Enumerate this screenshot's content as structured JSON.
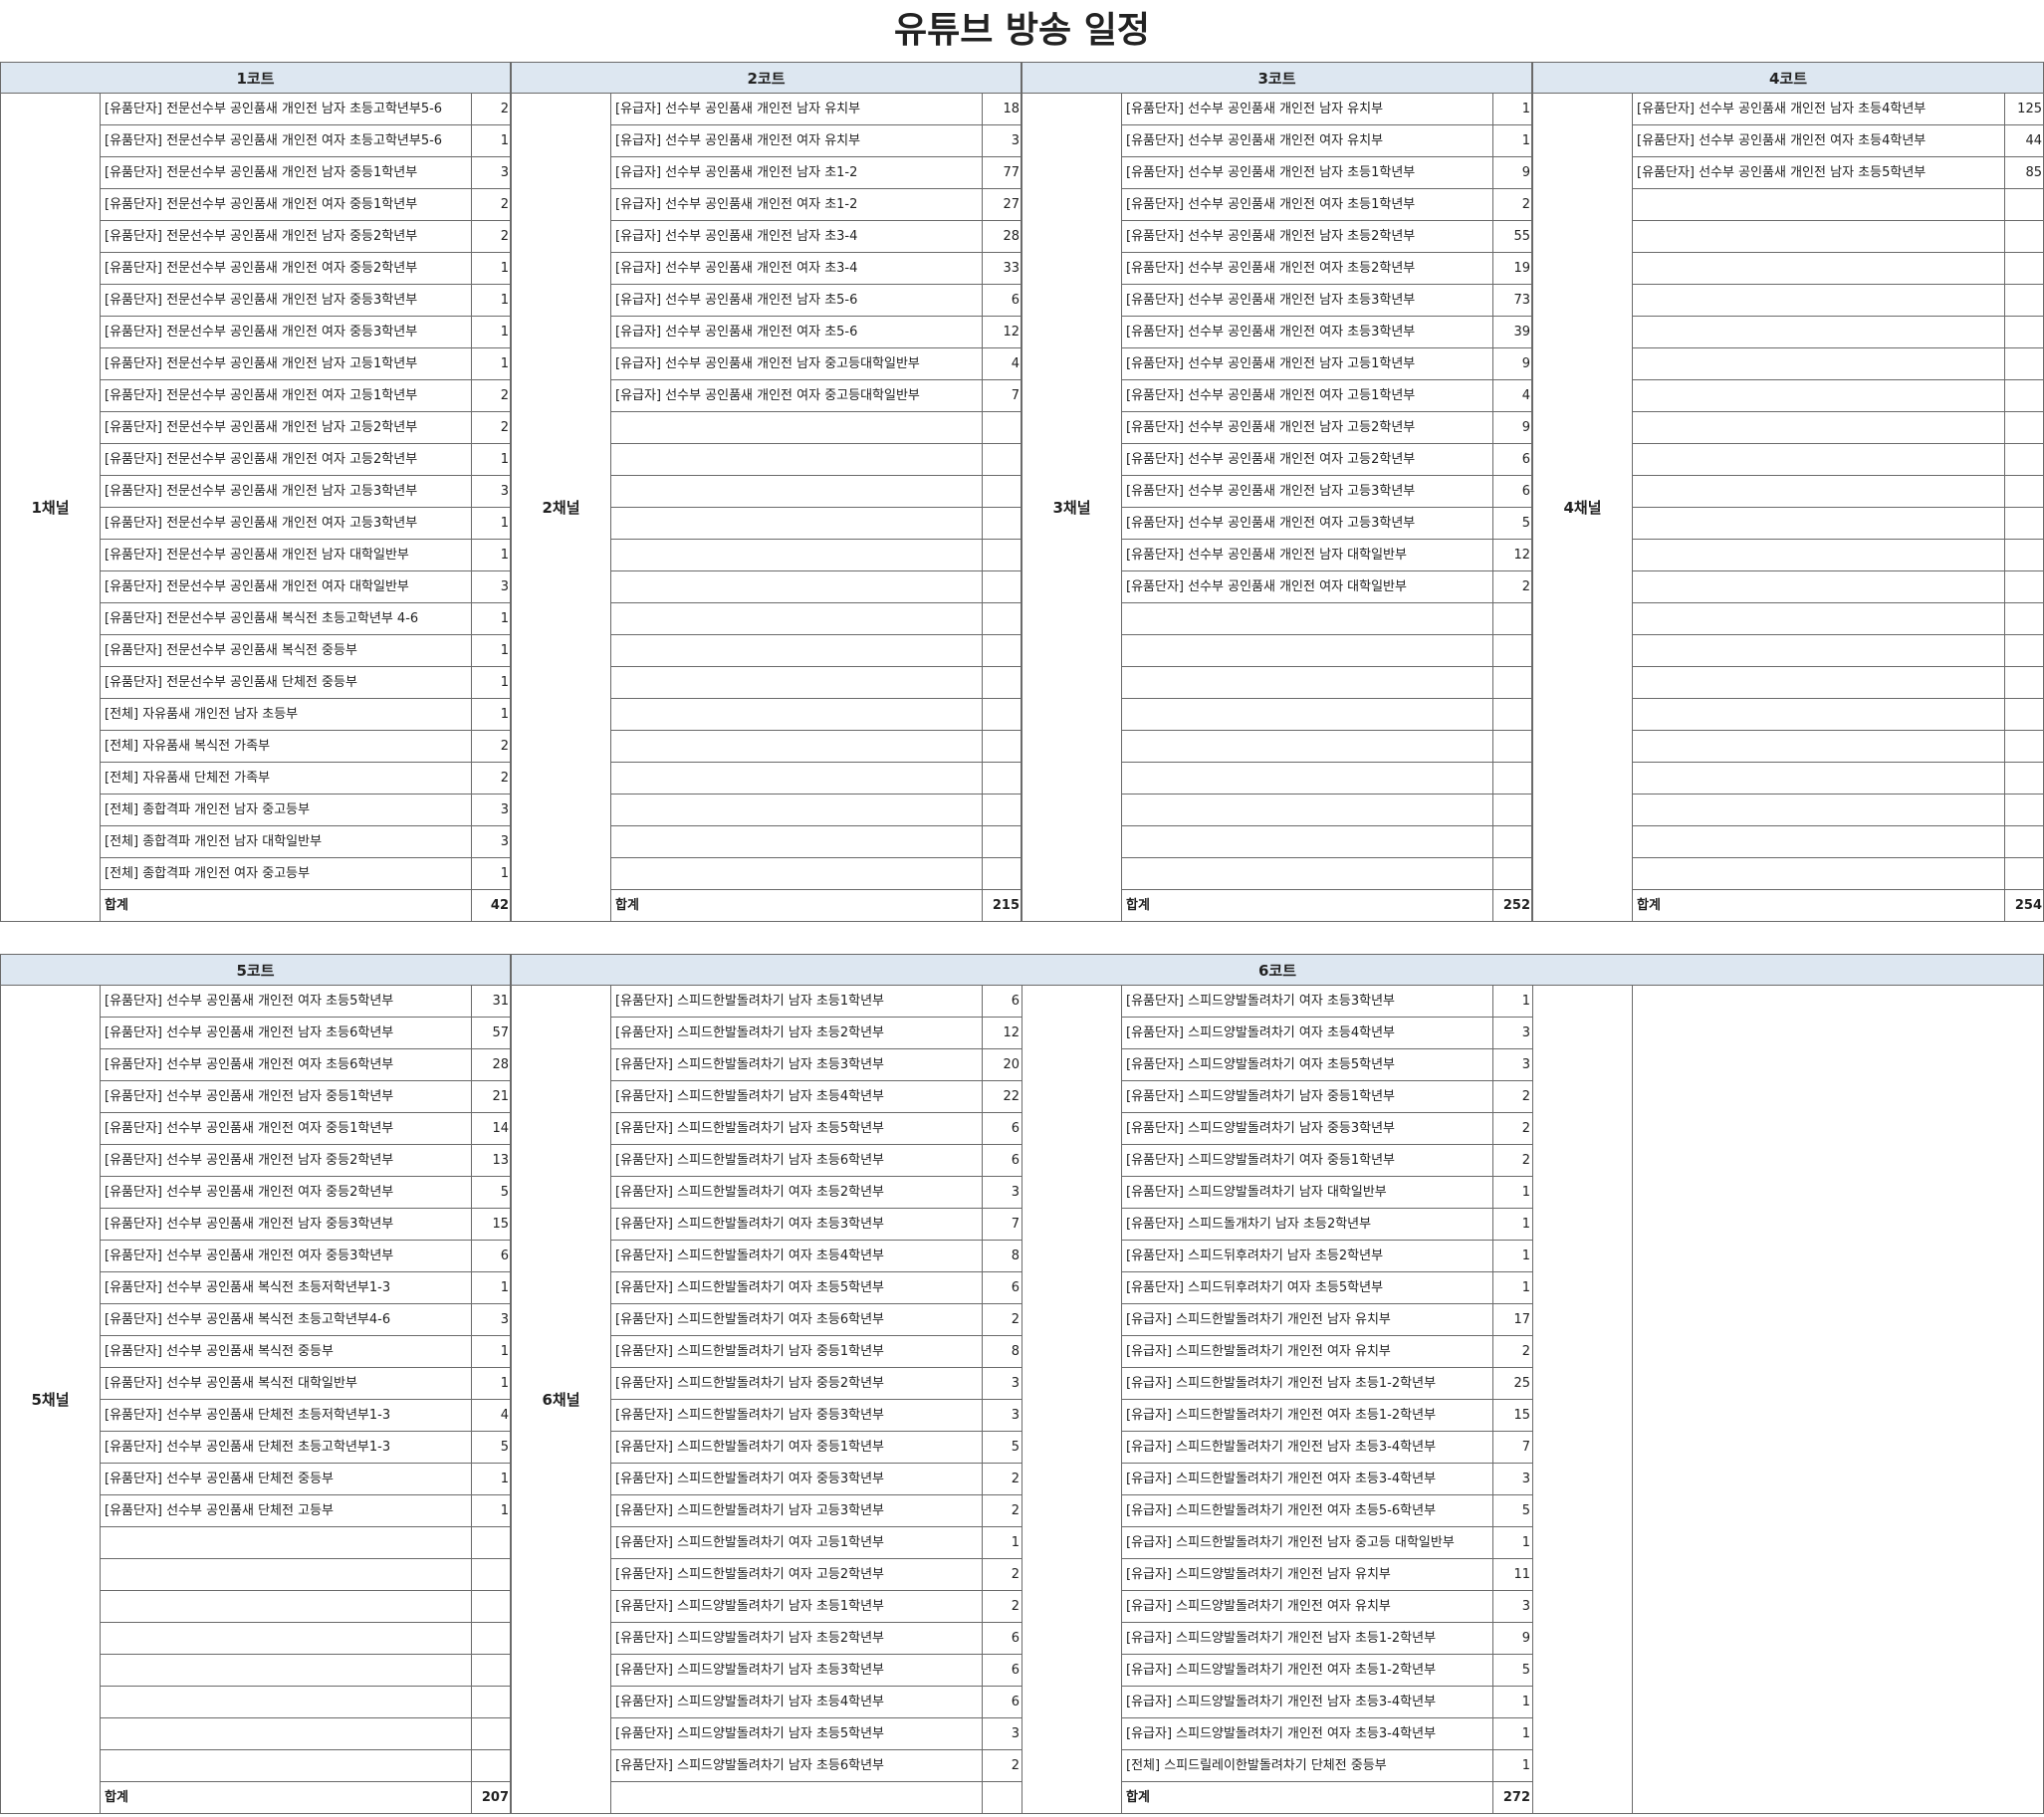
{
  "title": "유튜브 방송 일정",
  "total_label": "합계",
  "courts": [
    {
      "label": "1코트",
      "channel": "1채널",
      "total": "42",
      "entries": [
        [
          "[유품단자] 전문선수부 공인품새 개인전 남자 초등고학년부5-6",
          "2"
        ],
        [
          "[유품단자] 전문선수부 공인품새 개인전 여자 초등고학년부5-6",
          "1"
        ],
        [
          "[유품단자] 전문선수부 공인품새 개인전 남자 중등1학년부",
          "3"
        ],
        [
          "[유품단자] 전문선수부 공인품새 개인전 여자 중등1학년부",
          "2"
        ],
        [
          "[유품단자] 전문선수부 공인품새 개인전 남자 중등2학년부",
          "2"
        ],
        [
          "[유품단자] 전문선수부 공인품새 개인전 여자 중등2학년부",
          "1"
        ],
        [
          "[유품단자] 전문선수부 공인품새 개인전 남자 중등3학년부",
          "1"
        ],
        [
          "[유품단자] 전문선수부 공인품새 개인전 여자 중등3학년부",
          "1"
        ],
        [
          "[유품단자] 전문선수부 공인품새 개인전 남자 고등1학년부",
          "1"
        ],
        [
          "[유품단자] 전문선수부 공인품새 개인전 여자 고등1학년부",
          "2"
        ],
        [
          "[유품단자] 전문선수부 공인품새 개인전 남자 고등2학년부",
          "2"
        ],
        [
          "[유품단자] 전문선수부 공인품새 개인전 여자 고등2학년부",
          "1"
        ],
        [
          "[유품단자] 전문선수부 공인품새 개인전 남자 고등3학년부",
          "3"
        ],
        [
          "[유품단자] 전문선수부 공인품새 개인전 여자 고등3학년부",
          "1"
        ],
        [
          "[유품단자] 전문선수부 공인품새 개인전 남자 대학일반부",
          "1"
        ],
        [
          "[유품단자] 전문선수부 공인품새 개인전 여자 대학일반부",
          "3"
        ],
        [
          "[유품단자] 전문선수부 공인품새 복식전 초등고학년부 4-6",
          "1"
        ],
        [
          "[유품단자] 전문선수부 공인품새 복식전 중등부",
          "1"
        ],
        [
          "[유품단자] 전문선수부 공인품새 단체전 중등부",
          "1"
        ],
        [
          "[전체] 자유품새 개인전 남자 초등부",
          "1"
        ],
        [
          "[전체] 자유품새 복식전 가족부",
          "2"
        ],
        [
          "[전체] 자유품새 단체전 가족부",
          "2"
        ],
        [
          "[전체] 종합격파 개인전 남자 중고등부",
          "3"
        ],
        [
          "[전체] 종합격파 개인전 남자 대학일반부",
          "3"
        ],
        [
          "[전체] 종합격파 개인전 여자 중고등부",
          "1"
        ]
      ]
    },
    {
      "label": "2코트",
      "channel": "2채널",
      "total": "215",
      "entries": [
        [
          "[유급자] 선수부 공인품새 개인전 남자 유치부",
          "18"
        ],
        [
          "[유급자] 선수부 공인품새 개인전 여자 유치부",
          "3"
        ],
        [
          "[유급자] 선수부 공인품새 개인전 남자 초1-2",
          "77"
        ],
        [
          "[유급자] 선수부 공인품새 개인전 여자 초1-2",
          "27"
        ],
        [
          "[유급자] 선수부 공인품새 개인전 남자 초3-4",
          "28"
        ],
        [
          "[유급자] 선수부 공인품새 개인전 여자 초3-4",
          "33"
        ],
        [
          "[유급자] 선수부 공인품새 개인전 남자 초5-6",
          "6"
        ],
        [
          "[유급자] 선수부 공인품새 개인전 여자 초5-6",
          "12"
        ],
        [
          "[유급자] 선수부 공인품새 개인전 남자 중고등대학일반부",
          "4"
        ],
        [
          "[유급자] 선수부 공인품새 개인전 여자 중고등대학일반부",
          "7"
        ]
      ]
    },
    {
      "label": "3코트",
      "channel": "3채널",
      "total": "252",
      "entries": [
        [
          "[유품단자] 선수부 공인품새 개인전 남자 유치부",
          "1"
        ],
        [
          "[유품단자] 선수부 공인품새 개인전 여자 유치부",
          "1"
        ],
        [
          "[유품단자] 선수부 공인품새 개인전 남자 초등1학년부",
          "9"
        ],
        [
          "[유품단자] 선수부 공인품새 개인전 여자 초등1학년부",
          "2"
        ],
        [
          "[유품단자] 선수부 공인품새 개인전 남자 초등2학년부",
          "55"
        ],
        [
          "[유품단자] 선수부 공인품새 개인전 여자 초등2학년부",
          "19"
        ],
        [
          "[유품단자] 선수부 공인품새 개인전 남자 초등3학년부",
          "73"
        ],
        [
          "[유품단자] 선수부 공인품새 개인전 여자 초등3학년부",
          "39"
        ],
        [
          "[유품단자] 선수부 공인품새 개인전 남자 고등1학년부",
          "9"
        ],
        [
          "[유품단자] 선수부 공인품새 개인전 여자 고등1학년부",
          "4"
        ],
        [
          "[유품단자] 선수부 공인품새 개인전 남자 고등2학년부",
          "9"
        ],
        [
          "[유품단자] 선수부 공인품새 개인전 여자 고등2학년부",
          "6"
        ],
        [
          "[유품단자] 선수부 공인품새 개인전 남자 고등3학년부",
          "6"
        ],
        [
          "[유품단자] 선수부 공인품새 개인전 여자 고등3학년부",
          "5"
        ],
        [
          "[유품단자] 선수부 공인품새 개인전 남자 대학일반부",
          "12"
        ],
        [
          "[유품단자] 선수부 공인품새 개인전 여자 대학일반부",
          "2"
        ]
      ]
    },
    {
      "label": "4코트",
      "channel": "4채널",
      "total": "254",
      "entries": [
        [
          "[유품단자] 선수부 공인품새 개인전 남자 초등4학년부",
          "125"
        ],
        [
          "[유품단자] 선수부 공인품새 개인전 여자 초등4학년부",
          "44"
        ],
        [
          "[유품단자] 선수부 공인품새 개인전 남자 초등5학년부",
          "85"
        ]
      ]
    },
    {
      "label": "5코트",
      "channel": "5채널",
      "total": "207",
      "entries": [
        [
          "[유품단자] 선수부 공인품새 개인전 여자 초등5학년부",
          "31"
        ],
        [
          "[유품단자] 선수부 공인품새 개인전 남자 초등6학년부",
          "57"
        ],
        [
          "[유품단자] 선수부 공인품새 개인전 여자 초등6학년부",
          "28"
        ],
        [
          "[유품단자] 선수부 공인품새 개인전 남자 중등1학년부",
          "21"
        ],
        [
          "[유품단자] 선수부 공인품새 개인전 여자 중등1학년부",
          "14"
        ],
        [
          "[유품단자] 선수부 공인품새 개인전 남자 중등2학년부",
          "13"
        ],
        [
          "[유품단자] 선수부 공인품새 개인전 여자 중등2학년부",
          "5"
        ],
        [
          "[유품단자] 선수부 공인품새 개인전 남자 중등3학년부",
          "15"
        ],
        [
          "[유품단자] 선수부 공인품새 개인전 여자 중등3학년부",
          "6"
        ],
        [
          "[유품단자] 선수부 공인품새 복식전 초등저학년부1-3",
          "1"
        ],
        [
          "[유품단자] 선수부 공인품새 복식전 초등고학년부4-6",
          "3"
        ],
        [
          "[유품단자] 선수부 공인품새 복식전 중등부",
          "1"
        ],
        [
          "[유품단자] 선수부 공인품새 복식전 대학일반부",
          "1"
        ],
        [
          "[유품단자] 선수부 공인품새 단체전 초등저학년부1-3",
          "4"
        ],
        [
          "[유품단자] 선수부 공인품새 단체전 초등고학년부1-3",
          "5"
        ],
        [
          "[유품단자] 선수부 공인품새 단체전 중등부",
          "1"
        ],
        [
          "[유품단자] 선수부 공인품새 단체전 고등부",
          "1"
        ]
      ]
    },
    {
      "label": "6코트",
      "channel": "6채널",
      "total": "272",
      "entries_a": [
        [
          "[유품단자] 스피드한발돌려차기 남자 초등1학년부",
          "6"
        ],
        [
          "[유품단자] 스피드한발돌려차기 남자 초등2학년부",
          "12"
        ],
        [
          "[유품단자] 스피드한발돌려차기 남자 초등3학년부",
          "20"
        ],
        [
          "[유품단자] 스피드한발돌려차기 남자 초등4학년부",
          "22"
        ],
        [
          "[유품단자] 스피드한발돌려차기 남자 초등5학년부",
          "6"
        ],
        [
          "[유품단자] 스피드한발돌려차기 남자 초등6학년부",
          "6"
        ],
        [
          "[유품단자] 스피드한발돌려차기 여자 초등2학년부",
          "3"
        ],
        [
          "[유품단자] 스피드한발돌려차기 여자 초등3학년부",
          "7"
        ],
        [
          "[유품단자] 스피드한발돌려차기 여자 초등4학년부",
          "8"
        ],
        [
          "[유품단자] 스피드한발돌려차기 여자 초등5학년부",
          "6"
        ],
        [
          "[유품단자] 스피드한발돌려차기 여자 초등6학년부",
          "2"
        ],
        [
          "[유품단자] 스피드한발돌려차기 남자 중등1학년부",
          "8"
        ],
        [
          "[유품단자] 스피드한발돌려차기 남자 중등2학년부",
          "3"
        ],
        [
          "[유품단자] 스피드한발돌려차기 남자 중등3학년부",
          "3"
        ],
        [
          "[유품단자] 스피드한발돌려차기 여자 중등1학년부",
          "5"
        ],
        [
          "[유품단자] 스피드한발돌려차기 여자 중등3학년부",
          "2"
        ],
        [
          "[유품단자] 스피드한발돌려차기 남자 고등3학년부",
          "2"
        ],
        [
          "[유품단자] 스피드한발돌려차기 여자 고등1학년부",
          "1"
        ],
        [
          "[유품단자] 스피드한발돌려차기 여자 고등2학년부",
          "2"
        ],
        [
          "[유품단자] 스피드양발돌려차기 남자 초등1학년부",
          "2"
        ],
        [
          "[유품단자] 스피드양발돌려차기 남자 초등2학년부",
          "6"
        ],
        [
          "[유품단자] 스피드양발돌려차기 남자 초등3학년부",
          "6"
        ],
        [
          "[유품단자] 스피드양발돌려차기 남자 초등4학년부",
          "6"
        ],
        [
          "[유품단자] 스피드양발돌려차기 남자 초등5학년부",
          "3"
        ],
        [
          "[유품단자] 스피드양발돌려차기 남자 초등6학년부",
          "2"
        ]
      ],
      "entries_b": [
        [
          "[유품단자] 스피드양발돌려차기 여자 초등3학년부",
          "1"
        ],
        [
          "[유품단자] 스피드양발돌려차기 여자 초등4학년부",
          "3"
        ],
        [
          "[유품단자] 스피드양발돌려차기 여자 초등5학년부",
          "3"
        ],
        [
          "[유품단자] 스피드양발돌려차기 남자 중등1학년부",
          "2"
        ],
        [
          "[유품단자] 스피드양발돌려차기 남자 중등3학년부",
          "2"
        ],
        [
          "[유품단자] 스피드양발돌려차기 여자 중등1학년부",
          "2"
        ],
        [
          "[유품단자] 스피드양발돌려차기 남자 대학일반부",
          "1"
        ],
        [
          "[유품단자] 스피드돌개차기 남자 초등2학년부",
          "1"
        ],
        [
          "[유품단자] 스피드뒤후려차기 남자 초등2학년부",
          "1"
        ],
        [
          "[유품단자] 스피드뒤후려차기 여자 초등5학년부",
          "1"
        ],
        [
          "[유급자] 스피드한발돌려차기 개인전 남자 유치부",
          "17"
        ],
        [
          "[유급자] 스피드한발돌려차기 개인전 여자 유치부",
          "2"
        ],
        [
          "[유급자] 스피드한발돌려차기 개인전 남자 초등1-2학년부",
          "25"
        ],
        [
          "[유급자] 스피드한발돌려차기 개인전 여자 초등1-2학년부",
          "15"
        ],
        [
          "[유급자] 스피드한발돌려차기 개인전 남자 초등3-4학년부",
          "7"
        ],
        [
          "[유급자] 스피드한발돌려차기 개인전 여자 초등3-4학년부",
          "3"
        ],
        [
          "[유급자] 스피드한발돌려차기 개인전 여자 초등5-6학년부",
          "5"
        ],
        [
          "[유급자] 스피드한발돌려차기 개인전 남자 중고등 대학일반부",
          "1"
        ],
        [
          "[유급자] 스피드양발돌려차기 개인전 남자 유치부",
          "11"
        ],
        [
          "[유급자] 스피드양발돌려차기 개인전 여자 유치부",
          "3"
        ],
        [
          "[유급자] 스피드양발돌려차기 개인전 남자 초등1-2학년부",
          "9"
        ],
        [
          "[유급자] 스피드양발돌려차기 개인전 여자 초등1-2학년부",
          "5"
        ],
        [
          "[유급자] 스피드양발돌려차기 개인전 남자 초등3-4학년부",
          "1"
        ],
        [
          "[유급자] 스피드양발돌려차기 개인전 여자 초등3-4학년부",
          "1"
        ],
        [
          "[전체] 스피드릴레이한발돌려차기 단체전 중등부",
          "1"
        ]
      ]
    }
  ]
}
